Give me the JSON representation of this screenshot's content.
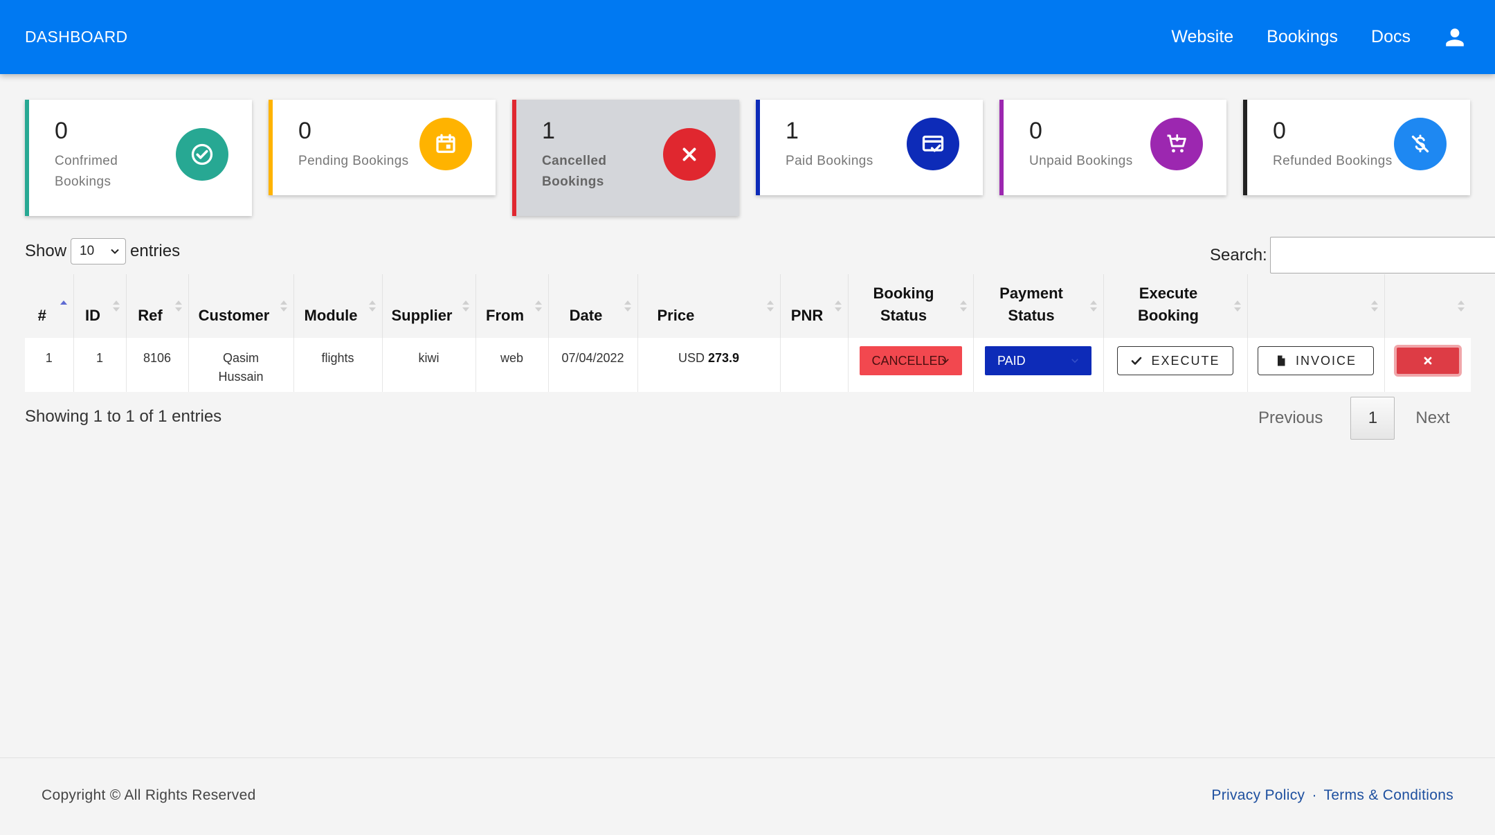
{
  "header": {
    "brand": "DASHBOARD",
    "nav": [
      "Website",
      "Bookings",
      "Docs"
    ],
    "color": "#0079f2"
  },
  "cards": [
    {
      "count": "0",
      "label": "Confrimed Bookings",
      "color": "#27a893",
      "icon": "check-circle-icon"
    },
    {
      "count": "0",
      "label": "Pending Bookings",
      "color": "#ffb300",
      "icon": "calendar-icon"
    },
    {
      "count": "1",
      "label": "Cancelled Bookings",
      "color": "#e0272f",
      "icon": "close-icon"
    },
    {
      "count": "1",
      "label": "Paid Bookings",
      "color": "#0d2bb8",
      "icon": "credit-card-check-icon"
    },
    {
      "count": "0",
      "label": "Unpaid Bookings",
      "color": "#9c27b0",
      "icon": "cart-icon"
    },
    {
      "count": "0",
      "label": "Refunded Bookings",
      "color": "#1e88f2",
      "icon": "no-dollar-icon"
    }
  ],
  "controls": {
    "show_label": "Show",
    "entries_value": "10",
    "entries_label": "entries",
    "search_label": "Search:",
    "search_value": ""
  },
  "table": {
    "columns": [
      "#",
      "ID",
      "Ref",
      "Customer",
      "Module",
      "Supplier",
      "From",
      "Date",
      "Price",
      "PNR",
      "Booking Status",
      "Payment Status",
      "Execute Booking",
      "",
      ""
    ],
    "rows": [
      {
        "num": "1",
        "id": "1",
        "ref": "8106",
        "customer": "Qasim Hussain",
        "module": "flights",
        "supplier": "kiwi",
        "from": "web",
        "date": "07/04/2022",
        "price_currency": "USD",
        "price_value": "273.9",
        "pnr": "",
        "booking_status": "CANCELLED",
        "payment_status": "PAID",
        "execute_label": "EXECUTE",
        "invoice_label": "INVOICE"
      }
    ]
  },
  "pagination": {
    "info": "Showing 1 to 1 of 1 entries",
    "previous": "Previous",
    "current": "1",
    "next": "Next"
  },
  "footer": {
    "copyright": "Copyright © All Rights Reserved",
    "privacy": "Privacy Policy",
    "separator": "·",
    "terms": "Terms & Conditions"
  }
}
